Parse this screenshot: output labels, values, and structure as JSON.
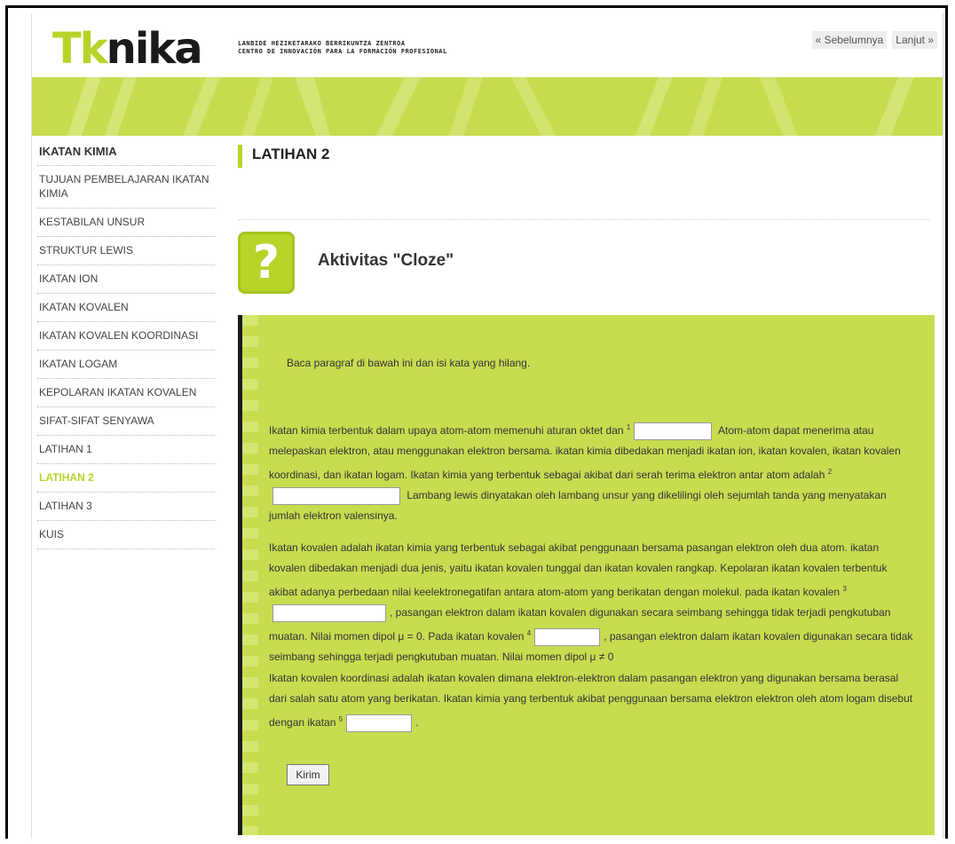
{
  "header": {
    "logo_part1": "Tk",
    "logo_part2": "nika",
    "tagline_line1": "LANBIDE HEZIKETARAKO BERRIKUNTZA ZENTROA",
    "tagline_line2": "CENTRO DE INNOVACIÓN PARA LA FORMACIÓN PROFESIONAL",
    "prev_label": "« Sebelumnya",
    "next_label": "Lanjut »"
  },
  "colors": {
    "accent": "#b7d42b",
    "banner": "#c8dc50",
    "active_text": "#b7d42b"
  },
  "sidebar": {
    "title": "IKATAN KIMIA",
    "items": [
      {
        "label": "TUJUAN PEMBELAJARAN IKATAN KIMIA"
      },
      {
        "label": "KESTABILAN UNSUR"
      },
      {
        "label": "STRUKTUR LEWIS"
      },
      {
        "label": "IKATAN ION"
      },
      {
        "label": "IKATAN KOVALEN"
      },
      {
        "label": "IKATAN KOVALEN KOORDINASI"
      },
      {
        "label": "IKATAN LOGAM"
      },
      {
        "label": "KEPOLARAN IKATAN KOVALEN"
      },
      {
        "label": "SIFAT-SIFAT SENYAWA"
      },
      {
        "label": "LATIHAN 1"
      },
      {
        "label": "LATIHAN 2",
        "active": true
      },
      {
        "label": "LATIHAN 3"
      },
      {
        "label": "KUIS"
      }
    ]
  },
  "main": {
    "section_title": "LATIHAN 2",
    "activity_icon": "question-mark-icon",
    "activity_glyph": "?",
    "activity_title": "Aktivitas \"Cloze\"",
    "instruction": "Baca paragraf di bawah ini dan isi kata yang hilang.",
    "p1": {
      "t1": "Ikatan kimia terbentuk dalam upaya atom-atom memenuhi aturan oktet dan ",
      "n1": "1",
      "t2": " Atom-atom dapat menerima atau melepaskan elektron, atau menggunakan elektron bersama. ikatan kimia dibedakan menjadi ikatan ion, ikatan kovalen, ikatan kovalen koordinasi, dan ikatan logam. Ikatan kimia yang terbentuk sebagai akibat dari serah terima elektron antar atom adalah ",
      "n2": "2",
      "t3": " Lambang lewis dinyatakan oleh lambang unsur yang dikelilingi oleh sejumlah tanda yang menyatakan jumlah elektron valensinya."
    },
    "p2": {
      "t1": "Ikatan kovalen adalah ikatan kimia yang terbentuk sebagai akibat penggunaan bersama pasangan elektron oleh dua atom. ikatan kovalen dibedakan menjadi dua jenis, yaitu ikatan kovalen tunggal dan ikatan kovalen rangkap. Kepolaran ikatan kovalen terbentuk akibat adanya perbedaan nilai keelektronegatifan antara atom-atom yang berikatan dengan molekul. pada ikatan kovalen ",
      "n3": "3",
      "t2": ", pasangan elektron dalam ikatan kovalen digunakan secara seimbang sehingga tidak terjadi pengkutuban muatan. Nilai momen dipol μ = 0. Pada ikatan kovalen ",
      "n4": "4",
      "t3": ", pasangan elektron dalam ikatan kovalen digunakan secara tidak seimbang sehingga terjadi pengkutuban muatan. Nilai momen dipol μ ≠ 0"
    },
    "p3": {
      "t1": "Ikatan kovalen koordinasi adalah ikatan kovalen dimana elektron-elektron dalam pasangan elektron yang digunakan bersama berasal dari salah satu atom yang berikatan. Ikatan kimia yang terbentuk akibat penggunaan bersama elektron elektron oleh atom logam disebut dengan ikatan ",
      "n5": "5",
      "t2": "."
    },
    "submit_label": "Kirim"
  }
}
